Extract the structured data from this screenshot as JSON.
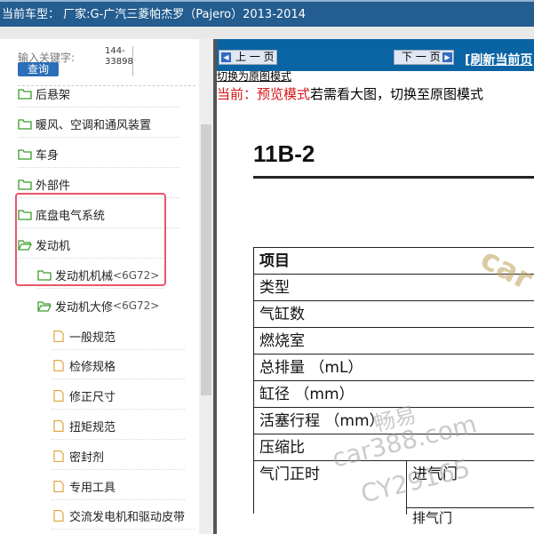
{
  "header": {
    "title": "当前车型： 厂家:G-广汽三菱帕杰罗（Pajero）2013-2014"
  },
  "search": {
    "label": "输入关键字:",
    "button": "查询",
    "value": "144-33898"
  },
  "sidebar": {
    "items": [
      {
        "label": "后悬架"
      },
      {
        "label": "暖风、空调和通风装置"
      },
      {
        "label": "车身"
      },
      {
        "label": "外部件"
      },
      {
        "label": "底盘电气系统"
      },
      {
        "label": "发动机"
      }
    ],
    "sub_items": [
      {
        "label": "发动机机械",
        "code": "<6G72>"
      },
      {
        "label": "发动机大修",
        "code": "<6G72>"
      }
    ],
    "docs": [
      {
        "label": "一般规范"
      },
      {
        "label": "检修规格"
      },
      {
        "label": "修正尺寸"
      },
      {
        "label": "扭矩规范"
      },
      {
        "label": "密封剂"
      },
      {
        "label": "专用工具"
      },
      {
        "label": "交流发电机和驱动皮带"
      }
    ]
  },
  "nav": {
    "prev": "上 一 页",
    "next": "下 一 页",
    "refresh": "[刷新当前页"
  },
  "mode": {
    "switch_link": "切换为原图模式",
    "prefix": "当前：",
    "mode_name": "预览模式",
    "suffix": "若需看大图，切换至原图模式"
  },
  "document": {
    "page_code": "11B-2",
    "table": {
      "header": "项目",
      "rows": [
        "类型",
        "气缸数",
        "燃烧室",
        "总排量 （mL）",
        "缸径 （mm）",
        "活塞行程 （mm）",
        "压缩比"
      ],
      "valve_timing": "气门正时",
      "intake": "进气门",
      "exhaust": "排气门"
    }
  },
  "watermark": {
    "brand": "car",
    "line1": "畅易",
    "line2": "car388.com",
    "line3": "CY29165"
  }
}
